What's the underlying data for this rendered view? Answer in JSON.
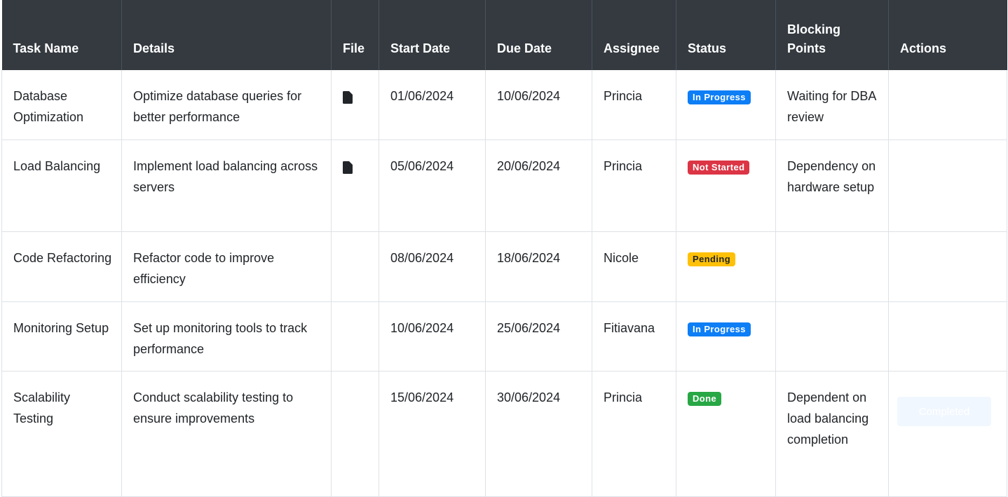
{
  "table": {
    "headers": {
      "task_name": "Task Name",
      "details": "Details",
      "file": "File",
      "start_date": "Start Date",
      "due_date": "Due Date",
      "assignee": "Assignee",
      "status": "Status",
      "blocking_points": "Blocking Points",
      "actions": "Actions"
    },
    "rows": [
      {
        "task_name": "Database Optimization",
        "details": "Optimize database queries for better performance",
        "has_file": true,
        "file_icon": "file-icon",
        "start_date": "01/06/2024",
        "due_date": "10/06/2024",
        "assignee": "Princia",
        "status": "In Progress",
        "status_color": "#0d7ef5",
        "blocking_points": "Waiting for DBA review",
        "action": ""
      },
      {
        "task_name": "Load Balancing",
        "details": "Implement load balancing across servers",
        "has_file": true,
        "file_icon": "file-icon",
        "start_date": "05/06/2024",
        "due_date": "20/06/2024",
        "assignee": "Princia",
        "status": "Not Started",
        "status_color": "#dc3545",
        "blocking_points": "Dependency on hardware setup",
        "action": ""
      },
      {
        "task_name": "Code Refactoring",
        "details": "Refactor code to improve efficiency",
        "has_file": false,
        "start_date": "08/06/2024",
        "due_date": "18/06/2024",
        "assignee": "Nicole",
        "status": "Pending",
        "status_color": "#ffc107",
        "blocking_points": "",
        "action": ""
      },
      {
        "task_name": "Monitoring Setup",
        "details": "Set up monitoring tools to track performance",
        "has_file": false,
        "start_date": "10/06/2024",
        "due_date": "25/06/2024",
        "assignee": "Fitiavana",
        "status": "In Progress",
        "status_color": "#0d7ef5",
        "blocking_points": "",
        "action": ""
      },
      {
        "task_name": "Scalability Testing",
        "details": "Conduct scalability testing to ensure improvements",
        "has_file": false,
        "start_date": "15/06/2024",
        "due_date": "30/06/2024",
        "assignee": "Princia",
        "status": "Done",
        "status_color": "#28a745",
        "blocking_points": "Dependent on load balancing completion",
        "action": "Completed"
      }
    ]
  },
  "colors": {
    "header_bg": "#343a40",
    "header_text": "#ffffff",
    "border": "#dee2e6",
    "completed_button_bg": "#f1f7ff"
  }
}
